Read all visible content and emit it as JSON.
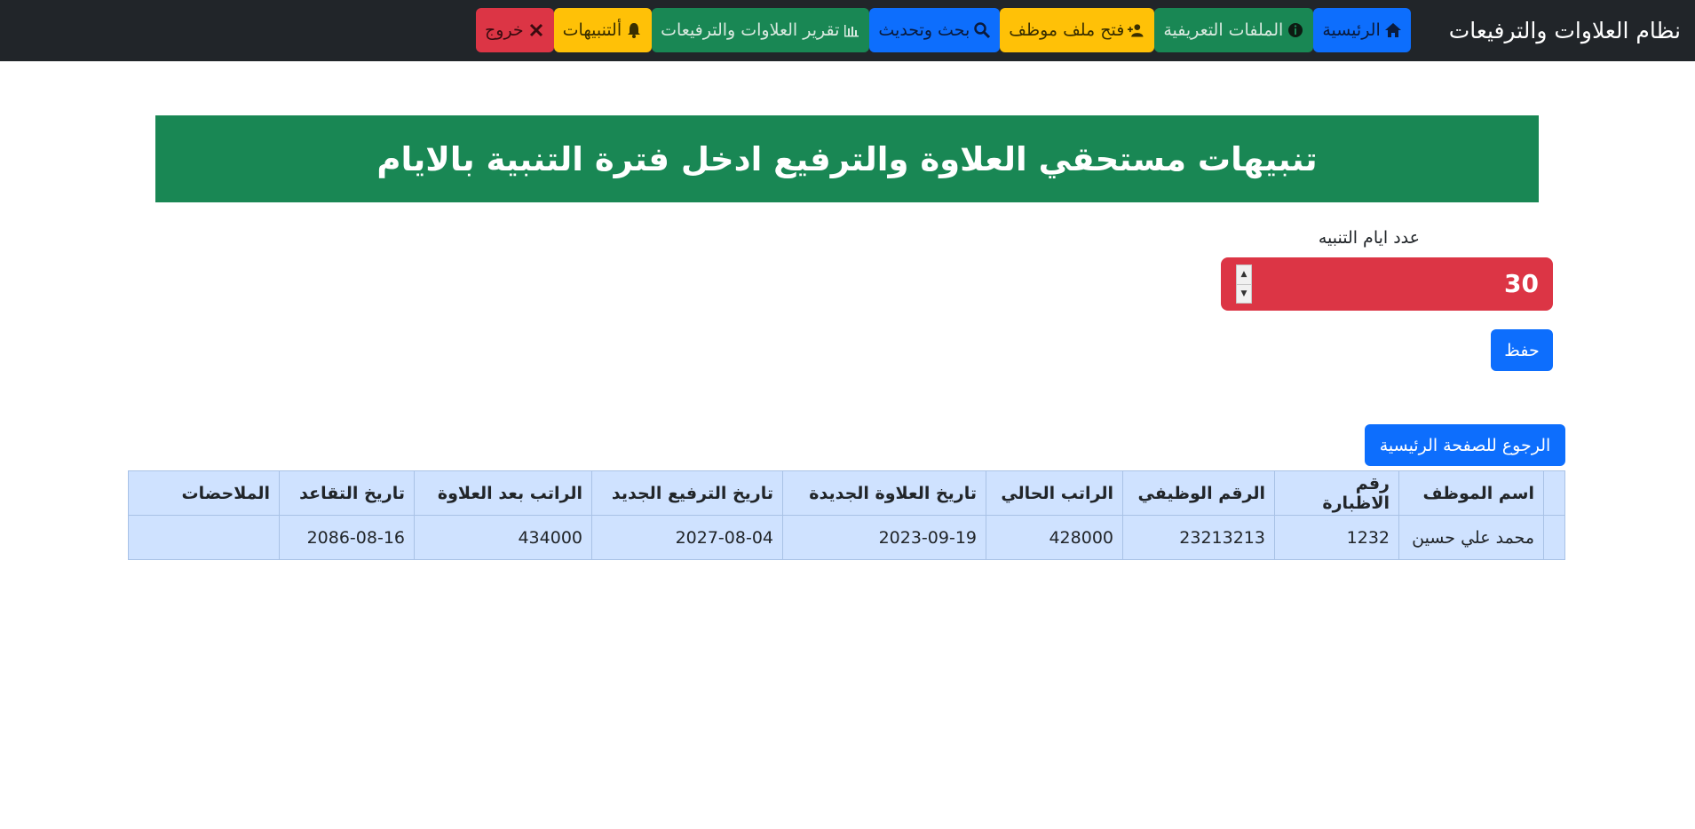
{
  "navbar": {
    "brand": "نظام العلاوات والترفيعات",
    "buttons": [
      {
        "id": "home",
        "label": "الرئيسية",
        "icon": "home-icon",
        "color": "#0d6efd"
      },
      {
        "id": "profiles",
        "label": "الملفات التعريفية",
        "icon": "info-icon",
        "color": "#198754"
      },
      {
        "id": "open-file",
        "label": "فتح ملف موظف",
        "icon": "user-plus-icon",
        "color": "#ffc107"
      },
      {
        "id": "search",
        "label": "بحث وتحديث",
        "icon": "search-icon",
        "color": "#0d6efd"
      },
      {
        "id": "report",
        "label": "تقرير العلاوات والترفيعات",
        "icon": "chart-icon",
        "color": "#198754"
      },
      {
        "id": "alerts",
        "label": "ألتنبيهات",
        "icon": "bell-icon",
        "color": "#ffc107"
      },
      {
        "id": "logout",
        "label": "خروج",
        "icon": "close-icon",
        "color": "#dc3545"
      }
    ]
  },
  "banner": {
    "title": "تنبيهات مستحقي العلاوة والترفيع ادخل فترة التنبية بالايام"
  },
  "form": {
    "label": "عدد ايام التنبيه",
    "value": "30",
    "save_label": "حفظ"
  },
  "back_button": {
    "label": "الرجوع للصفحة الرئيسية"
  },
  "table": {
    "headers": [
      "اسم الموظف",
      "رقم الاظبارة",
      "الرقم الوظيفي",
      "الراتب الحالي",
      "تاريخ العلاوة الجديدة",
      "تاريخ الترفيع الجديد",
      "الراتب بعد العلاوة",
      "تاريخ التقاعد",
      "الملاحضات"
    ],
    "rows": [
      [
        "محمد علي حسين",
        "1232",
        "23213213",
        "428000",
        "2023-09-19",
        "2027-08-04",
        "434000",
        "2086-08-16",
        ""
      ]
    ]
  }
}
